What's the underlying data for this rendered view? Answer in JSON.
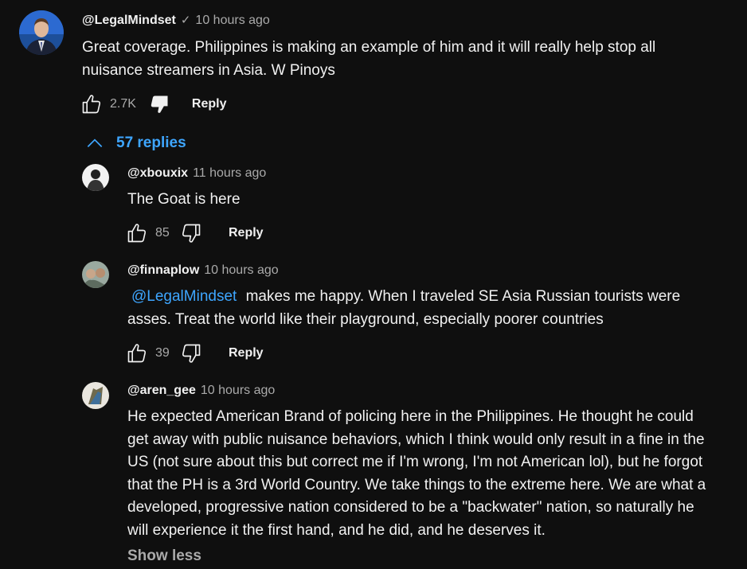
{
  "colors": {
    "background": "#0f0f0f",
    "text": "#f1f1f1",
    "secondary_text": "#aaaaaa",
    "link": "#3ea6ff"
  },
  "top_comment": {
    "author": "@LegalMindset",
    "verified_icon": "check-icon",
    "time": "10 hours ago",
    "text_line1": "Great coverage. Philippines is making an example of him and it will really help stop all",
    "text_line2": "nuisance streamers in Asia. W Pinoys",
    "likes": "2.7K",
    "reply_label": "Reply"
  },
  "replies_toggle": {
    "label": "57 replies",
    "icon": "chevron-up-icon"
  },
  "replies": [
    {
      "author": "@xbouxix",
      "time": "11 hours ago",
      "text_line1": "The Goat is here",
      "likes": "85",
      "reply_label": "Reply"
    },
    {
      "author": "@finnaplow",
      "time": "10 hours ago",
      "mention": "@LegalMindset",
      "text_line1_rest": " makes me happy. When I traveled SE Asia Russian tourists were",
      "text_line2": "asses. Treat the world like their playground, especially poorer countries",
      "likes": "39",
      "reply_label": "Reply"
    },
    {
      "author": "@aren_gee",
      "time": "10 hours ago",
      "lines": [
        "He expected American Brand of policing here in the Philippines. He thought he could",
        "get away with public nuisance behaviors, which I think would only result in a fine in the",
        "US (not sure about this but correct me if I'm wrong, I'm not American lol), but he forgot",
        "that the PH is a 3rd World Country. We take things to the extreme here. We are what a",
        "developed, progressive nation considered to be a \"backwater\" nation, so naturally he",
        "will experience it the first hand, and he did, and he deserves it."
      ],
      "show_less_label": "Show less"
    }
  ]
}
